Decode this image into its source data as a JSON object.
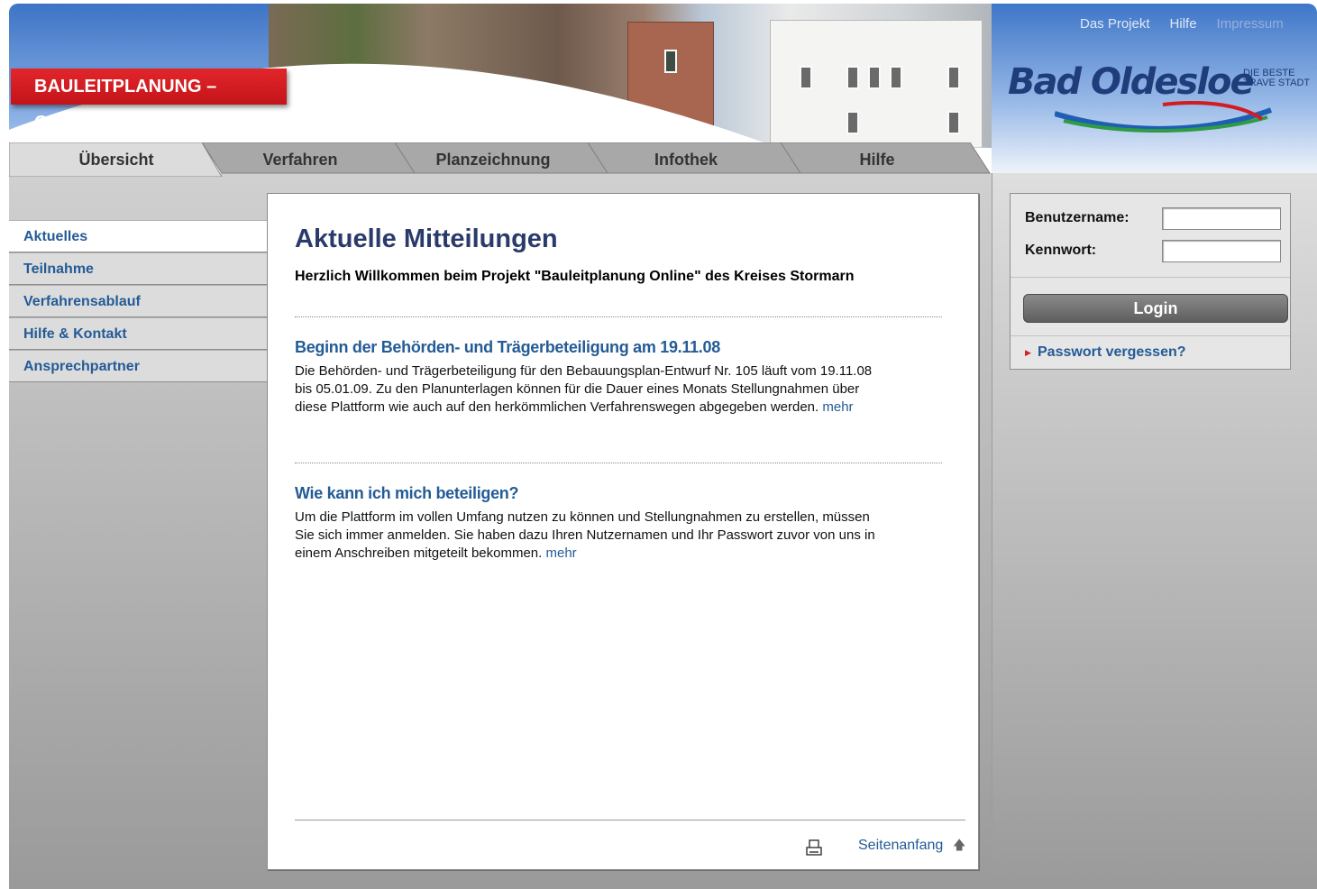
{
  "header": {
    "top_links": [
      "Das Projekt",
      "Hilfe",
      "Impressum"
    ],
    "banner_title": "BAULEITPLANUNG – ONLINE",
    "logo_name": "Bad Oldesloe",
    "logo_tagline": "DIE BESTE TRAVE STADT"
  },
  "tabs": [
    {
      "label": "Übersicht",
      "active": true
    },
    {
      "label": "Verfahren",
      "active": false
    },
    {
      "label": "Planzeichnung",
      "active": false
    },
    {
      "label": "Infothek",
      "active": false
    },
    {
      "label": "Hilfe",
      "active": false
    }
  ],
  "sidebar": {
    "items": [
      {
        "label": "Aktuelles",
        "active": true
      },
      {
        "label": "Teilnahme",
        "active": false
      },
      {
        "label": "Verfahrensablauf",
        "active": false
      },
      {
        "label": "Hilfe & Kontakt",
        "active": false
      },
      {
        "label": "Ansprechpartner",
        "active": false
      }
    ]
  },
  "main": {
    "title": "Aktuelle Mitteilungen",
    "welcome": "Herzlich Willkommen beim Projekt \"Bauleitplanung Online\" des Kreises Stormarn",
    "news": [
      {
        "heading": "Beginn der Behörden- und Trägerbeteiligung am 19.11.08",
        "text": "Die Behörden- und Trägerbeteiligung für den Bebauungsplan-Entwurf Nr. 105 läuft vom 19.11.08 bis 05.01.09. Zu den Planunterlagen können für die Dauer eines Monats Stellungnahmen über diese Plattform wie auch auf den herkömmlichen Verfahrenswegen abgegeben werden.",
        "more": "mehr"
      },
      {
        "heading": "Wie kann ich mich beteiligen?",
        "text": "Um die Plattform im vollen Umfang nutzen zu können und Stellungnahmen zu erstellen, müssen Sie sich immer anmelden. Sie haben dazu Ihren Nutzernamen und Ihr Passwort zuvor von uns in einem Anschreiben mitgeteilt bekommen.",
        "more": "mehr"
      }
    ],
    "footer": {
      "top_link": "Seitenanfang"
    }
  },
  "login": {
    "username_label": "Benutzername:",
    "username_value": "",
    "password_label": "Kennwort:",
    "password_value": "",
    "button": "Login",
    "forgot": "Passwort vergessen?"
  },
  "colors": {
    "brand_red": "#d11c21",
    "link_blue": "#245b96",
    "title_navy": "#2a3a6a"
  }
}
